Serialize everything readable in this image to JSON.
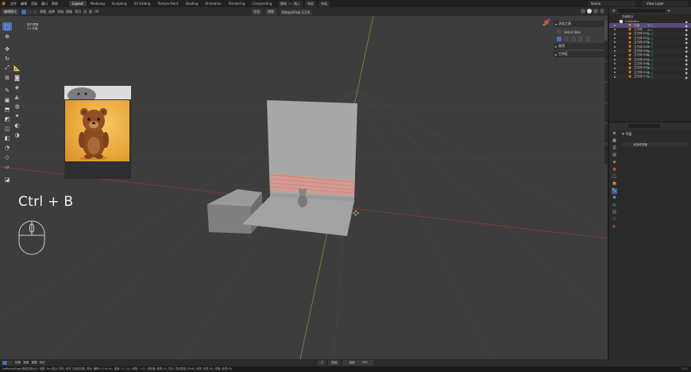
{
  "topbar": {
    "menu": [
      "文件",
      "编辑",
      "渲染",
      "窗口",
      "帮助"
    ],
    "workspaces": [
      "Layout",
      "Modeling",
      "Sculpting",
      "UV Editing",
      "Texture Paint",
      "Shading",
      "Animation",
      "Rendering",
      "Compositing",
      "Scripting"
    ],
    "active_workspace": "Layout",
    "center": [
      "物体",
      "插入",
      "布局",
      "布局"
    ],
    "scene": "Scene",
    "view_layer": "View Layer"
  },
  "viewport_header": {
    "mode": "编辑模式",
    "menus": [
      "视图",
      "选择",
      "添加",
      "网格",
      "顶点",
      "边",
      "面",
      "UV"
    ],
    "transform_orientation": "全局",
    "snap": "增量",
    "addon": "RetopoFlow 3.2.8"
  },
  "viewport": {
    "view_name": "用户透视",
    "object_label": "(1) 平面"
  },
  "keycast": {
    "keys": "Ctrl + B"
  },
  "npanel": {
    "section_tool": "活动工具",
    "tool_name": "Select Box",
    "section_options": "选项",
    "section_workspace": "工作区"
  },
  "outliner": {
    "crumb": "场景集合",
    "collection": "Collection",
    "items": [
      {
        "name": "平面",
        "selected": true
      },
      {
        "name": "立方体",
        "selected": false
      },
      {
        "name": "立方体.001",
        "selected": false
      },
      {
        "name": "立方体.002",
        "selected": false
      },
      {
        "name": "立方体.003",
        "selected": false
      },
      {
        "name": "立方体.004",
        "selected": false
      },
      {
        "name": "立方体.005",
        "selected": false
      },
      {
        "name": "立方体.006",
        "selected": false
      },
      {
        "name": "立方体.007",
        "selected": false
      },
      {
        "name": "立方体.008",
        "selected": false
      },
      {
        "name": "立方体.009",
        "selected": false
      },
      {
        "name": "立方体.010",
        "selected": false
      },
      {
        "name": "立方体.011",
        "selected": false
      }
    ]
  },
  "properties": {
    "object_name": "平面",
    "add_modifier": "添加修改器"
  },
  "timeline": {
    "menus": [
      "回放",
      "抠像",
      "视图",
      "标记"
    ],
    "frame_current": "1",
    "frame_start": "起始",
    "frame_end": "结束",
    "frame_end_value": "250"
  },
  "status": {
    "text": "selMouseEdge(滚轮变量大小: 调整, Esc:退出; 鼠标: 收敛 已选择边框, 滚轮: 偏移: 0.194 m), 宽度: 0.5 (小), 段数: 1 (C), 修改器: 倒角 (V), 顶点: 顶点数量 (Shift), 轮廓: 轮廓 (H), 厚度: 轮廓 (R)",
    "version": "3.2.1"
  },
  "colors": {
    "accent": "#4772b3",
    "selected_row": "#5a4a7a",
    "object_tri": "#e0842a",
    "modifier": "#5ec8c0",
    "viewport_bg": "#3d3d3d"
  }
}
